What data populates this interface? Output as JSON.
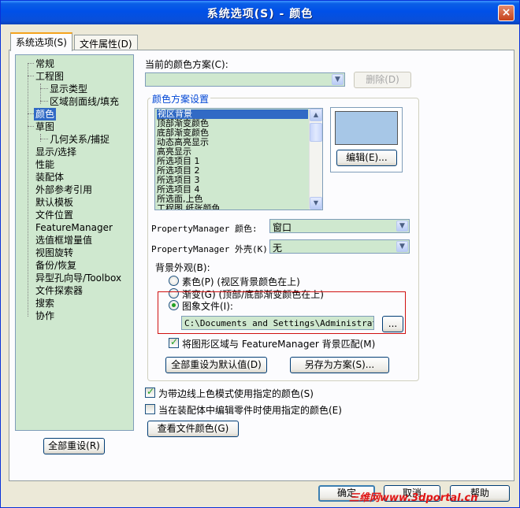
{
  "window": {
    "title": "系统选项(S) - 颜色",
    "close_label": "×"
  },
  "tabs": [
    {
      "label": "系统选项(S)",
      "active": true
    },
    {
      "label": "文件属性(D)",
      "active": false
    }
  ],
  "tree": {
    "items": [
      {
        "label": "常规"
      },
      {
        "label": "工程图"
      },
      {
        "label": "显示类型"
      },
      {
        "label": "区域剖面线/填充"
      },
      {
        "label": "颜色",
        "selected": true
      },
      {
        "label": "草图"
      },
      {
        "label": "几何关系/捕捉"
      },
      {
        "label": "显示/选择"
      },
      {
        "label": "性能"
      },
      {
        "label": "装配体"
      },
      {
        "label": "外部参考引用"
      },
      {
        "label": "默认模板"
      },
      {
        "label": "文件位置"
      },
      {
        "label": "FeatureManager"
      },
      {
        "label": "选值框增量值"
      },
      {
        "label": "视图旋转"
      },
      {
        "label": "备份/恢复"
      },
      {
        "label": "异型孔向导/Toolbox"
      },
      {
        "label": "文件探索器"
      },
      {
        "label": "搜索"
      },
      {
        "label": "协作"
      }
    ],
    "reset_all_button": "全部重设(R)"
  },
  "scheme": {
    "label": "当前的颜色方案(C):",
    "value": "",
    "delete_button": "删除(D)"
  },
  "scheme_settings": {
    "group_title": "颜色方案设置",
    "list_items": [
      "视区背景",
      "顶部渐变颜色",
      "底部渐变颜色",
      "动态高亮显示",
      "高亮显示",
      "所选项目 1",
      "所选项目 2",
      "所选项目 3",
      "所选项目 4",
      "所选面,上色",
      "工程图,纸张颜色"
    ],
    "edit_button": "编辑(E)...",
    "preview_color": "#a7c7e7"
  },
  "pm_color": {
    "label": "PropertyManager 颜色:",
    "value": "窗口"
  },
  "pm_skin": {
    "label": "PropertyManager 外壳(K):",
    "value": "无"
  },
  "background": {
    "label": "背景外观(B):",
    "options": [
      {
        "label": "素色(P) (视区背景颜色在上)",
        "checked": false
      },
      {
        "label": "渐变(G) (顶部/底部渐变颜色在上)",
        "checked": false
      },
      {
        "label": "图象文件(I):",
        "checked": true
      }
    ],
    "image_path": "C:\\Documents and Settings\\Administrator\\",
    "browse_button": "...",
    "match_feature_manager": {
      "label": "将图形区域与 FeatureManager 背景匹配(M)",
      "checked": true
    }
  },
  "buttons": {
    "reset_defaults": "全部重设为默认值(D)",
    "save_as_scheme": "另存为方案(S)...",
    "view_doc_colors": "查看文件颜色(G)",
    "ok": "确定",
    "cancel": "取消",
    "help": "帮助"
  },
  "checkboxes": {
    "edge_shading": {
      "label": "为带边线上色模式使用指定的颜色(S)",
      "checked": true
    },
    "assembly_edit": {
      "label": "当在装配体中编辑零件时使用指定的颜色(E)",
      "checked": false
    }
  },
  "watermark": "三维网www.3dportal.cn",
  "colors": {
    "accent": "#316ac5",
    "field_bg": "#cfe8cf",
    "title_blue": "#0050e8",
    "group_title": "#0046d5"
  }
}
